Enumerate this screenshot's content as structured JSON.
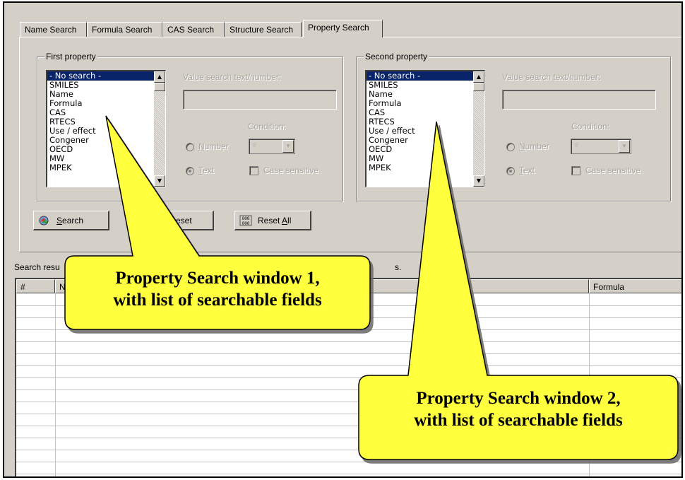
{
  "tabs": [
    {
      "label": "Name Search"
    },
    {
      "label": "Formula Search"
    },
    {
      "label": "CAS Search"
    },
    {
      "label": "Structure Search"
    },
    {
      "label": "Property Search"
    }
  ],
  "first_property": {
    "legend": "First property",
    "items": [
      "- No search -",
      "SMILES",
      "Name",
      "Formula",
      "CAS",
      "RTECS",
      "Use / effect",
      "Congener",
      "OECD",
      "MW",
      "MPEK"
    ],
    "selected_index": 0,
    "value_label": "Value search text/number:",
    "value": "",
    "condition_label": "Condition:",
    "condition_value": "=",
    "number_label_pre": "",
    "number_label_u": "N",
    "number_label_post": "umber",
    "text_label_u": "T",
    "text_label_post": "ext",
    "case_label": "Case sensitive",
    "selected_radio": "text"
  },
  "second_property": {
    "legend": "Second property",
    "items": [
      "- No search -",
      "SMILES",
      "Name",
      "Formula",
      "CAS",
      "RTECS",
      "Use / effect",
      "Congener",
      "OECD",
      "MW",
      "MPEK"
    ],
    "selected_index": 0,
    "value_label": "Value search text/number:",
    "value": "",
    "condition_label": "Condition:",
    "condition_value": "=",
    "number_label_u": "N",
    "number_label_post": "umber",
    "text_label_u": "T",
    "text_label_post": "ext",
    "case_label": "Case sensitive",
    "selected_radio": "text"
  },
  "buttons": {
    "search_u": "S",
    "search_rest": "earch",
    "reset_visible": "eset",
    "reset_all_pre": "Reset ",
    "reset_all_u": "A",
    "reset_all_post": "ll"
  },
  "results": {
    "label_left": "Search resu",
    "label_right": "s.",
    "columns": [
      {
        "label": "#"
      },
      {
        "label": "N"
      },
      {
        "label": "Formula"
      }
    ]
  },
  "callouts": {
    "one_line1": "Property Search window 1,",
    "one_line2": "with list of searchable fields",
    "two_line1": "Property Search window 2,",
    "two_line2": "with list of searchable fields",
    "fill_color": "#ffff3c"
  },
  "colors": {
    "window_bg": "#d4d0c8",
    "selection_bg": "#0a246a"
  }
}
